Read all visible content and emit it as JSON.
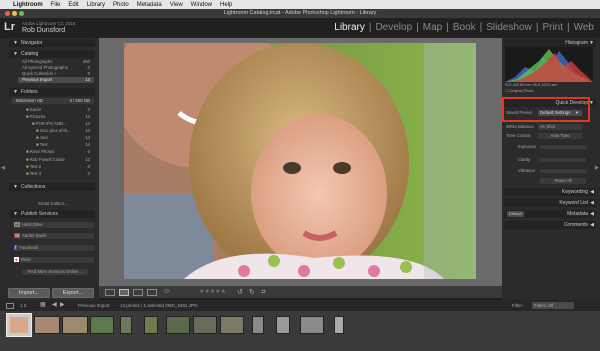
{
  "menubar": {
    "apple": "",
    "app": "Lightroom",
    "items": [
      "File",
      "Edit",
      "Library",
      "Photo",
      "Metadata",
      "View",
      "Window",
      "Help"
    ]
  },
  "window": {
    "title": "Lightroom Catalog.lrcat - Adobe Photoshop Lightroom - Library"
  },
  "identity": {
    "logo": "Lr",
    "product": "Adobe Lightroom CC 2015",
    "user": "Rob Dunsford"
  },
  "modules": [
    "Library",
    "Develop",
    "Map",
    "Book",
    "Slideshow",
    "Print",
    "Web"
  ],
  "modules_sep": "|",
  "left": {
    "navigator": {
      "title": "Navigator",
      "zoom": "FIT  FILL  1:1  3:1"
    },
    "catalog": {
      "title": "Catalog",
      "items": [
        {
          "label": "All Photographs",
          "count": "450"
        },
        {
          "label": "All Synced Photographs",
          "count": "0"
        },
        {
          "label": "Quick Collection +",
          "count": "0"
        },
        {
          "label": "Previous Import",
          "count": "13"
        }
      ]
    },
    "folders": {
      "title": "Folders",
      "volume": "Macintosh HD",
      "volume_info": "4 / 500 GB",
      "items": [
        {
          "label": "Karen",
          "count": "0"
        },
        {
          "label": "Pictures",
          "count": "14"
        },
        {
          "label": "FOR IPS AND...",
          "count": "14"
        },
        {
          "label": "misc pics of th...",
          "count": "14"
        },
        {
          "label": "Joel",
          "count": "14"
        },
        {
          "label": "Test",
          "count": "14"
        },
        {
          "label": "Rose Photos",
          "count": "0"
        },
        {
          "label": "Rob Powell Castle",
          "count": "13"
        },
        {
          "label": "Test 2",
          "count": "0"
        },
        {
          "label": "Test 3",
          "count": "0"
        }
      ]
    },
    "collections": {
      "title": "Collections",
      "item": "Smart Collect..."
    },
    "publish": {
      "title": "Publish Services",
      "items": [
        "Hard Drive",
        "Adobe Stock",
        "Facebook",
        "Flickr"
      ],
      "find_more": "Find More Services Online..."
    },
    "import_btn": "Import...",
    "export_btn": "Export..."
  },
  "right": {
    "histogram": {
      "title": "Histogram",
      "info": "ISO 400   60 mm   f/5.6   1/200 sec",
      "original": "Original Photo"
    },
    "quick_develop": {
      "title": "Quick Develop",
      "saved_preset_label": "Saved Preset",
      "saved_preset_value": "Default Settings",
      "white_balance_label": "White Balance",
      "white_balance_value": "As Shot",
      "tone_control_label": "Tone Control",
      "auto_tone": "Auto Tone",
      "rows": [
        "Exposure",
        "Clarity",
        "Vibrance"
      ],
      "reset": "Reset All"
    },
    "keywording": "Keywording",
    "keyword_list": "Keyword List",
    "metadata": "Metadata",
    "metadata_default": "Default",
    "comments": "Comments"
  },
  "filmstrip": {
    "page": "1  2",
    "source": "Previous Import",
    "count": "13 photos / 1 selected /IMG_5491.JPG",
    "filter_label": "Filter :",
    "filter_value": "Filters Off"
  },
  "colors": {
    "accent": "#e03a1a"
  }
}
